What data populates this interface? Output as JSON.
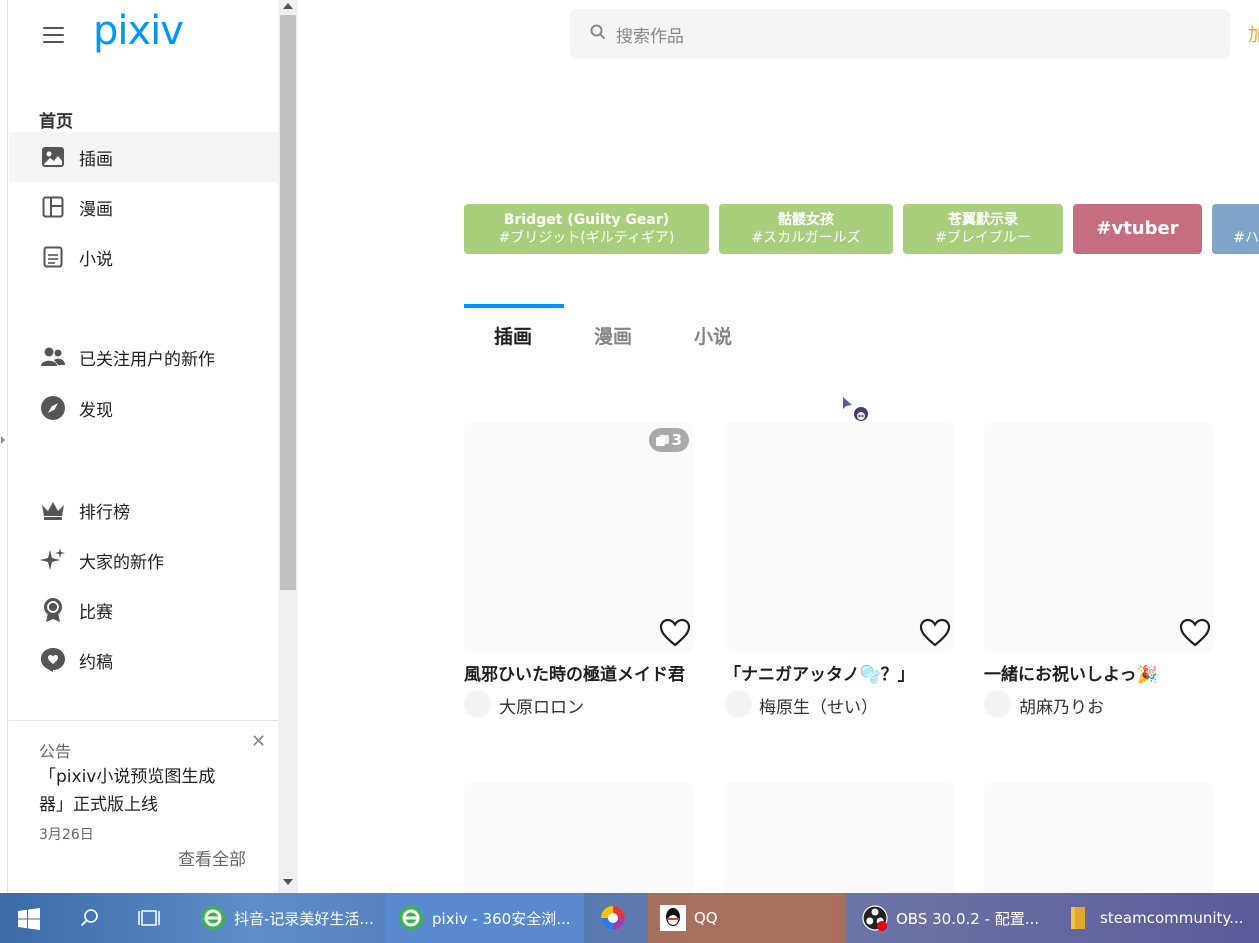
{
  "sidebar": {
    "logo": "pixiv",
    "section_title": "首页",
    "items": [
      {
        "label": "插画",
        "icon": "illustration-icon",
        "active": true
      },
      {
        "label": "漫画",
        "icon": "manga-icon"
      },
      {
        "label": "小说",
        "icon": "novel-icon"
      },
      {
        "label": "已关注用户的新作",
        "icon": "following-icon"
      },
      {
        "label": "发现",
        "icon": "compass-icon"
      },
      {
        "label": "排行榜",
        "icon": "crown-icon"
      },
      {
        "label": "大家的新作",
        "icon": "sparkle-icon"
      },
      {
        "label": "比赛",
        "icon": "medal-icon"
      },
      {
        "label": "约稿",
        "icon": "request-icon"
      }
    ],
    "notice": {
      "title": "公告",
      "text": "「pixiv小说预览图生成器」正式版上线",
      "date": "3月26日",
      "view_all": "查看全部"
    }
  },
  "search": {
    "placeholder": "搜索作品"
  },
  "header_cut_text": "加",
  "tags": [
    {
      "line1": "Bridget (Guilty Gear)",
      "line2": "#ブリジット(ギルティギア)",
      "color": "#a8cf7c"
    },
    {
      "line1": "骷髅女孩",
      "line2": "#スカルガールズ",
      "color": "#a8cf7c"
    },
    {
      "line1": "苍翼默示录",
      "line2": "#ブレイブルー",
      "color": "#a8cf7c"
    },
    {
      "line1": "#vtuber",
      "line2": "",
      "color": "#c46e80"
    },
    {
      "line1": "",
      "line2": "#ハ",
      "color": "#7ea6c8"
    }
  ],
  "tabs": [
    {
      "label": "插画",
      "active": true
    },
    {
      "label": "漫画"
    },
    {
      "label": "小说"
    }
  ],
  "works": [
    {
      "title": "風邪ひいた時の極道メイド君",
      "author": "大原ロロン",
      "pages": "3"
    },
    {
      "title": "「ナニガアッタノ🫧？」",
      "author": "梅原生（せい）",
      "pages": ""
    },
    {
      "title": "一緒にお祝いしよっ🎉",
      "author": "胡麻乃りお",
      "pages": ""
    }
  ],
  "taskbar": {
    "items": [
      {
        "label": "抖音-记录美好生活...",
        "icon": "browser-360-icon"
      },
      {
        "label": "pixiv - 360安全浏...",
        "icon": "browser-360-icon",
        "active": true
      },
      {
        "label": "",
        "icon": "color-wheel-icon"
      },
      {
        "label": "QQ",
        "icon": "qq-icon"
      },
      {
        "label": "OBS 30.0.2 - 配置...",
        "icon": "obs-icon"
      },
      {
        "label": "steamcommunity...",
        "icon": "folder-icon"
      }
    ]
  },
  "colors": {
    "accent": "#0096fa",
    "tag_green": "#a8cf7c",
    "tag_pink": "#c46e80",
    "tag_blue": "#7ea6c8"
  }
}
